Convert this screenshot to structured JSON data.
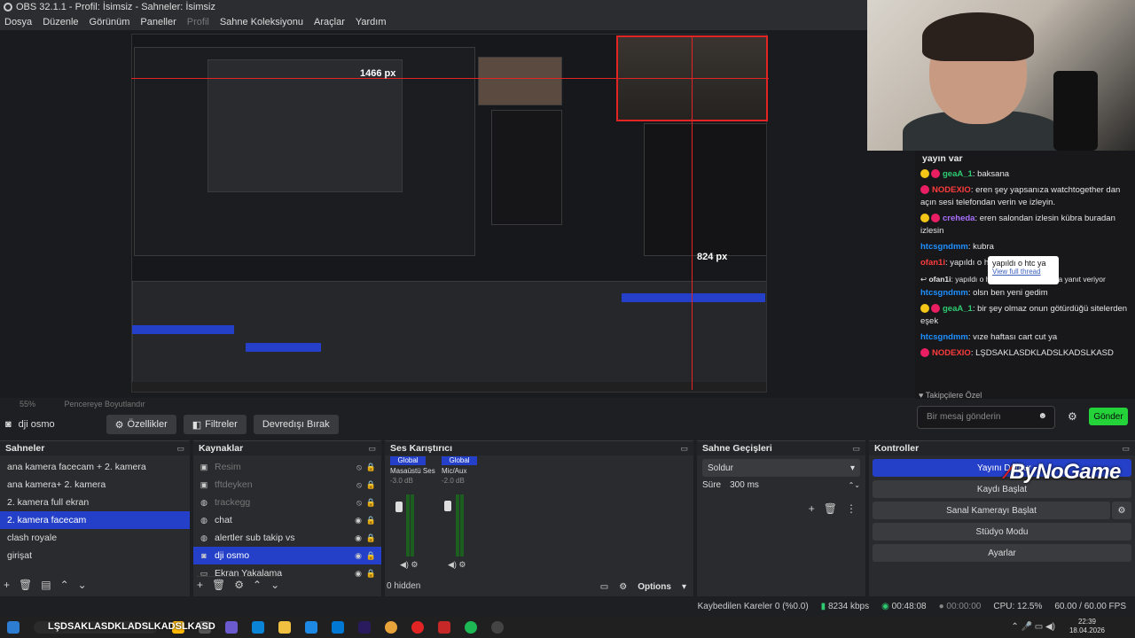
{
  "window": {
    "title": "OBS 32.1.1 - Profil: İsimsiz - Sahneler: İsimsiz"
  },
  "menu": [
    "Dosya",
    "Düzenle",
    "Görünüm",
    "Paneller",
    "Profil",
    "Sahne Koleksiyonu",
    "Araçlar",
    "Yardım"
  ],
  "preview": {
    "width_label": "1466 px",
    "height_label": "824 px",
    "zoom": "55%",
    "resize_label": "Pencereye Boyutlandır"
  },
  "chat": {
    "header": "yayın var",
    "messages": [
      {
        "user": "geaA_1",
        "text": ": baksana",
        "color": "green"
      },
      {
        "user": "NODEXIO",
        "text": ": eren şey yapsanıza watchtogether dan açın sesi telefondan verin ve izleyin.",
        "color": "red"
      },
      {
        "user": "creheda",
        "text": ": eren salondan izlesin kübra buradan izlesin",
        "color": "purple"
      },
      {
        "user": "htcsgndmm",
        "text": ": kubra",
        "color": "blue"
      },
      {
        "user": "ofan1i",
        "text": ": yapıldı o htc",
        "color": "red"
      },
      {
        "user": "ofan1i",
        "text": ": yapıldı o htc ya isimli kullanıcıya yanıt veriyor",
        "color": "none"
      },
      {
        "user": "htcsgndmm",
        "text": ": olsn ben yeni gedim",
        "color": "blue"
      },
      {
        "user": "geaA_1",
        "text": ": bir şey olmaz onun götürdüğü sitelerden eşek",
        "color": "green"
      },
      {
        "user": "htcsgndmm",
        "text": ": vıze haftası cart cut ya",
        "color": "blue"
      },
      {
        "user": "NODEXIO",
        "text": ": LŞDSAKLASDKLADSLKADSLKASD",
        "color": "red"
      }
    ],
    "tooltip_text": "yapıldı o htc ya",
    "tooltip_link": "View full thread",
    "follower_label": "Takipçilere Özel",
    "input_placeholder": "Bir mesaj gönderin",
    "send_label": "Gönder"
  },
  "source_bar": {
    "name": "dji osmo",
    "properties": "Özellikler",
    "filters": "Filtreler",
    "disable": "Devredışı Bırak"
  },
  "scenes": {
    "title": "Sahneler",
    "items": [
      "ana kamera facecam + 2. kamera",
      "ana kamera+ 2. kamera",
      "2. kamera full ekran",
      "2. kamera  facecam",
      "clash royale",
      "girişat"
    ],
    "selected_index": 3
  },
  "sources": {
    "title": "Kaynaklar",
    "items": [
      {
        "name": "Resim",
        "hidden": true
      },
      {
        "name": "tftdeyken",
        "hidden": true
      },
      {
        "name": "trackegg",
        "hidden": true
      },
      {
        "name": "chat",
        "hidden": false
      },
      {
        "name": "alertler sub takip vs",
        "hidden": false
      },
      {
        "name": "dji osmo",
        "hidden": false
      },
      {
        "name": "Ekran Yakalama",
        "hidden": false
      }
    ],
    "selected_index": 5
  },
  "mixer": {
    "title": "Ses Karıştırıcı",
    "channels": [
      {
        "tag": "Global",
        "name": "Masaüstü Ses",
        "db": "-3.0 dB",
        "level": 0.8
      },
      {
        "tag": "Global",
        "name": "Mic/Aux",
        "db": "-2.0 dB",
        "level": 0.82
      }
    ],
    "hidden_label": "0 hidden",
    "options_label": "Options"
  },
  "transitions": {
    "title": "Sahne Geçişleri",
    "type": "Soldur",
    "duration_label": "Süre",
    "duration": "300 ms"
  },
  "controls": {
    "title": "Kontroller",
    "buttons": [
      "Yayını Durdur",
      "Kaydı Başlat",
      "Sanal Kamerayı Başlat",
      "Stüdyo Modu",
      "Ayarlar"
    ]
  },
  "status": {
    "dropped": "Kaybedilen Kareler 0 (%0.0)",
    "bitrate": "8234 kbps",
    "stream_time": "00:48:08",
    "rec_time": "00:00:00",
    "cpu": "CPU: 12.5%",
    "fps": "60.00 / 60.00 FPS"
  },
  "taskbar": {
    "ticker": "LŞDSAKLASDKLADSLKADSLKASD",
    "time": "22:39",
    "date": "18.04.2026"
  },
  "overlay": {
    "brand": "ByNoGame"
  }
}
